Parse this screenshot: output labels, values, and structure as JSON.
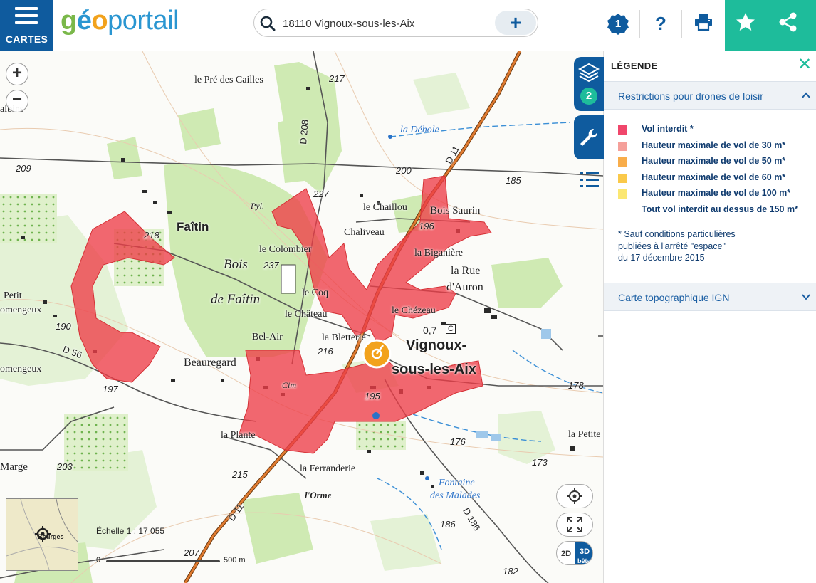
{
  "header": {
    "menu_label": "CARTES",
    "logo": {
      "part1": "g",
      "part2": "é",
      "part3": "o",
      "part4": "portail"
    },
    "search": {
      "value": "18110 Vignoux-sous-les-Aix",
      "placeholder": "",
      "add_symbol": "+"
    },
    "notification_count": "1",
    "help_symbol": "?",
    "icons": [
      "menu-icon",
      "search-icon",
      "plus-icon",
      "notification-badge-icon",
      "help-icon",
      "print-icon",
      "star-icon",
      "share-icon"
    ]
  },
  "map": {
    "zoom_in": "+",
    "zoom_out": "−",
    "scale_label": "Échelle 1 : 17 055",
    "scale_bar": {
      "start": "0",
      "end": "500 m"
    },
    "minimap_town": "Bourges",
    "dimension_toggle": {
      "two_d": "2D",
      "three_d": "3D",
      "beta": "bêta"
    },
    "labels": {
      "pre_des_cailles": "le Pré des Cailles",
      "alt_217": "217",
      "albins": "albins",
      "d208": "D 208",
      "la_dehole": "la Déhole",
      "d11_top": "D 11",
      "alt_209": "209",
      "alt_200": "200",
      "alt_185": "185",
      "alt_227": "227",
      "pyl": "Pyl.",
      "le_chaillou": "le Chaillou",
      "bois_saurin": "Bois Saurin",
      "faitin": "Faîtin",
      "alt_218": "218",
      "alt_196": "196",
      "chaliveau": "Chaliveau",
      "le_colombier": "le Colombier",
      "la_biganiere": "la Biganière",
      "bois": "Bois",
      "alt_237": "237",
      "la_rue": "la Rue",
      "dauron": "d'Auron",
      "petit": "Petit",
      "omengeux": "omengeux",
      "de_faitin": "de Faîtin",
      "le_coq": "le Coq",
      "le_chezeau": "le Chézeau",
      "le_chateau": "le Château",
      "alt_190": "190",
      "alt_07": "0,7",
      "c_marker": "C",
      "bel_air": "Bel-Air",
      "la_bletterie": "la Bletterie",
      "vignoux_1": "Vignoux-",
      "vignoux_2": "sous-les-Aix",
      "d56": "D 56",
      "alt_216": "216",
      "comengeux": "omengeux",
      "beauregard": "Beauregard",
      "cim": "Cim",
      "alt_197": "197",
      "alt_195": "195",
      "alt_178": "178",
      "la_plante": "la Plante",
      "la_petite": "la Petite",
      "alt_176": "176",
      "marge": "Marge",
      "alt_203": "203",
      "alt_173": "173",
      "alt_215": "215",
      "la_ferranderie": "la Ferranderie",
      "fontaine": "Fontaine",
      "des_malades": "des Malades",
      "lorme": "l'Orme",
      "d11_bottom": "D 11",
      "d186": "D 186",
      "alt_186": "186",
      "alt_207": "207",
      "alt_182": "182"
    }
  },
  "rail": {
    "layers_count": "2"
  },
  "legend": {
    "title": "LÉGENDE",
    "close_symbol": "✕",
    "section_drones": "Restrictions pour drones de loisir",
    "items": [
      {
        "label": "Vol interdit *",
        "color": "#f0466b"
      },
      {
        "label": "Hauteur maximale de vol de 30 m*",
        "color": "#f5a09a"
      },
      {
        "label": "Hauteur maximale de vol de 50 m*",
        "color": "#f8ad4b"
      },
      {
        "label": "Hauteur maximale de vol de 60 m*",
        "color": "#fac94a"
      },
      {
        "label": "Hauteur maximale de vol de 100 m*",
        "color": "#fbe772"
      },
      {
        "label": "Tout vol interdit au dessus de 150 m*",
        "color": "#ffffff"
      }
    ],
    "note": [
      "* Sauf conditions particulières",
      "publiées à l'arrêté \"espace\"",
      "du 17 décembre 2015"
    ],
    "section_topo": "Carte topographique IGN"
  },
  "colors": {
    "brand_blue": "#0f5b9e",
    "teal": "#1ebc9b",
    "restriction": "#ee3e48",
    "forest": "#cde9b1",
    "road_orange": "#e07a2f"
  }
}
